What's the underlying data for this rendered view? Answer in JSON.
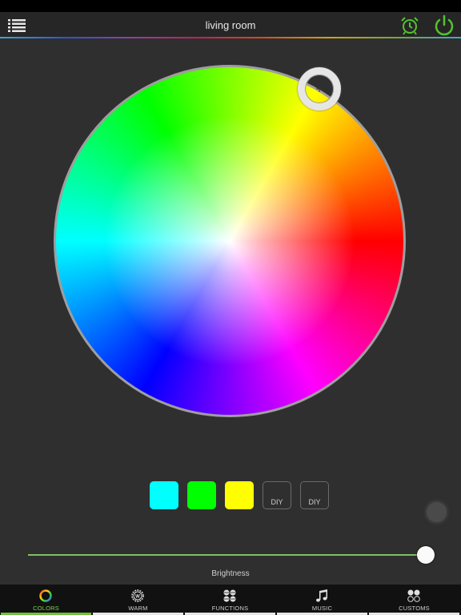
{
  "header": {
    "title": "living room",
    "menu_icon": "list-icon",
    "alarm_icon": "alarm-clock-icon",
    "power_icon": "power-icon",
    "accent_color": "#54c22f"
  },
  "color_wheel": {
    "selected_color": "#ffff33"
  },
  "swatches": [
    {
      "color": "#00ffff",
      "label": ""
    },
    {
      "color": "#00ff00",
      "label": ""
    },
    {
      "color": "#ffff00",
      "label": ""
    },
    {
      "color": "",
      "label": "DIY"
    },
    {
      "color": "",
      "label": "DIY"
    }
  ],
  "brightness": {
    "label": "Brightness",
    "value": 1.0
  },
  "tabs": [
    {
      "label": "COLORS",
      "icon": "color-ring-icon",
      "active": true
    },
    {
      "label": "WARM",
      "icon": "warm-gear-icon",
      "active": false
    },
    {
      "label": "FUNCTIONS",
      "icon": "functions-grid-icon",
      "active": false
    },
    {
      "label": "MUSIC",
      "icon": "music-note-icon",
      "active": false
    },
    {
      "label": "CUSTOMS",
      "icon": "customs-circles-icon",
      "active": false
    }
  ]
}
